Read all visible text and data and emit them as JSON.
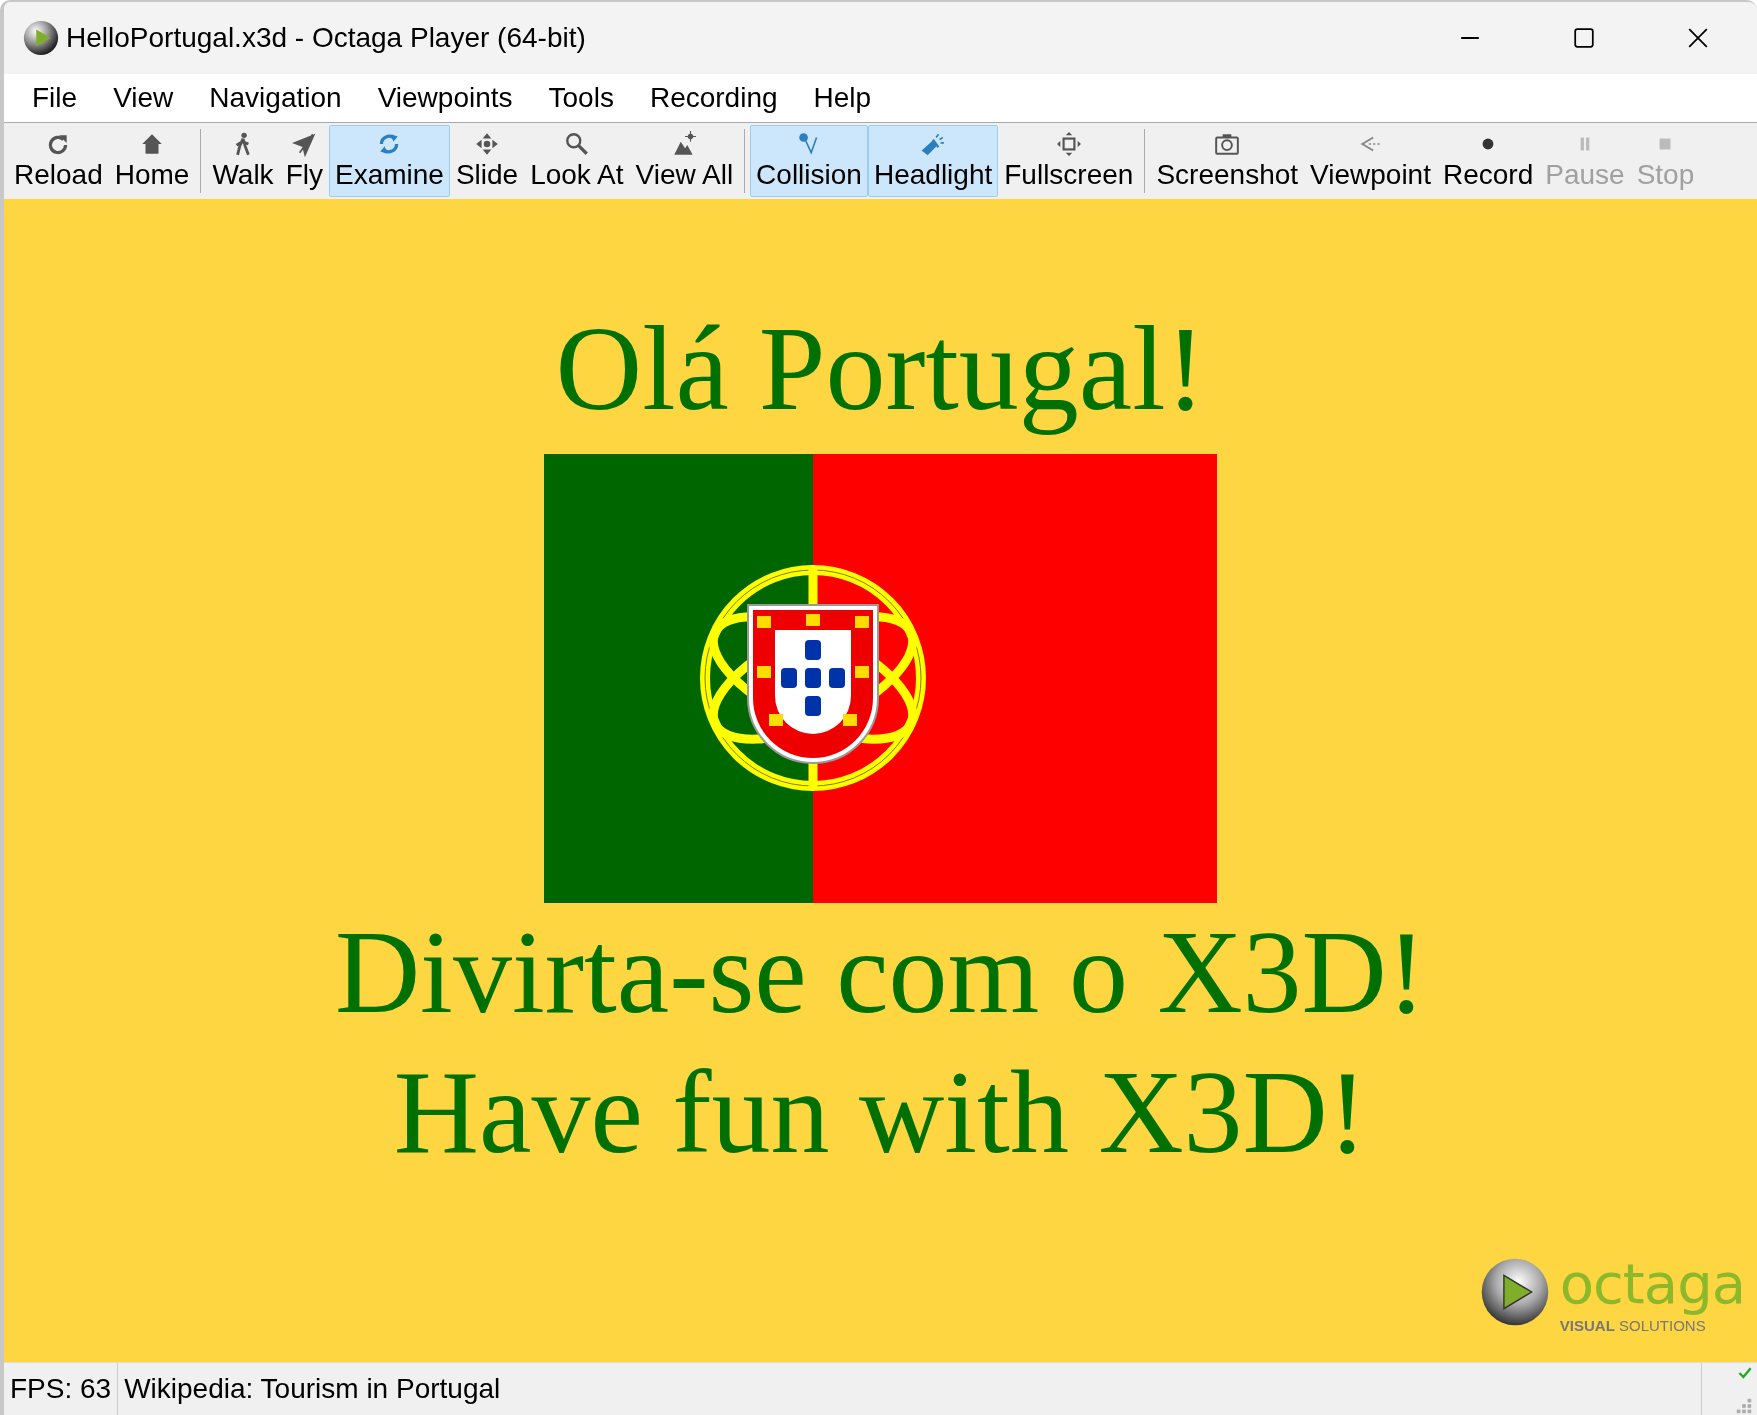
{
  "window": {
    "title": "HelloPortugal.x3d - Octaga Player (64-bit)"
  },
  "menu": [
    "File",
    "View",
    "Navigation",
    "Viewpoints",
    "Tools",
    "Recording",
    "Help"
  ],
  "toolbar": [
    [
      {
        "label": "Reload",
        "kind": "reload",
        "selected": false,
        "disabled": false
      },
      {
        "label": "Home",
        "kind": "home",
        "selected": false,
        "disabled": false
      }
    ],
    [
      {
        "label": "Walk",
        "kind": "walk",
        "selected": false,
        "disabled": false
      },
      {
        "label": "Fly",
        "kind": "fly",
        "selected": false,
        "disabled": false
      },
      {
        "label": "Examine",
        "kind": "examine",
        "selected": true,
        "disabled": false
      },
      {
        "label": "Slide",
        "kind": "slide",
        "selected": false,
        "disabled": false
      },
      {
        "label": "Look At",
        "kind": "lookat",
        "selected": false,
        "disabled": false
      },
      {
        "label": "View All",
        "kind": "viewall",
        "selected": false,
        "disabled": false
      }
    ],
    [
      {
        "label": "Collision",
        "kind": "collision",
        "selected": true,
        "disabled": false
      },
      {
        "label": "Headlight",
        "kind": "headlight",
        "selected": true,
        "disabled": false
      },
      {
        "label": "Fullscreen",
        "kind": "fullscreen",
        "selected": false,
        "disabled": false
      }
    ],
    [
      {
        "label": "Screenshot",
        "kind": "screenshot",
        "selected": false,
        "disabled": false
      },
      {
        "label": "Viewpoint",
        "kind": "viewpoint",
        "selected": false,
        "disabled": false
      },
      {
        "label": "Record",
        "kind": "record",
        "selected": false,
        "disabled": false
      },
      {
        "label": "Pause",
        "kind": "pause",
        "selected": false,
        "disabled": true
      },
      {
        "label": "Stop",
        "kind": "stop",
        "selected": false,
        "disabled": true
      }
    ]
  ],
  "scene": {
    "heading": "Olá Portugal!",
    "lines": [
      "Divirta-se com o X3D!",
      "Have fun with X3D!"
    ]
  },
  "logo": {
    "name": "octaga",
    "tagline": "**VISUAL** SOLUTIONS"
  },
  "status_bar": {
    "fps": "FPS: 63",
    "message": "Wikipedia: Tourism in Portugal"
  }
}
